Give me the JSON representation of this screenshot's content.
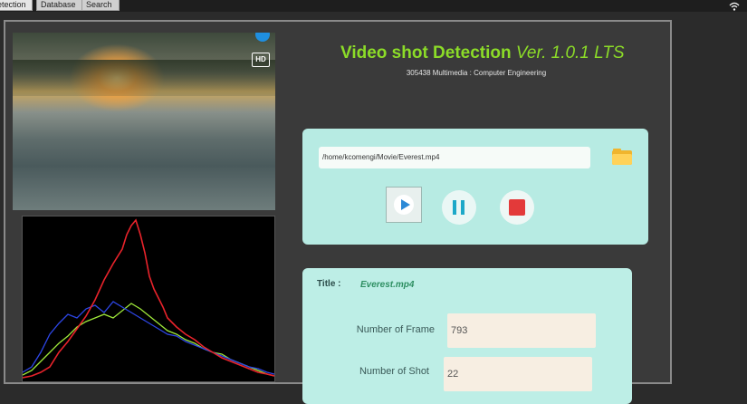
{
  "tabs": [
    "etection",
    "Database",
    "Search"
  ],
  "app": {
    "title_main": "Video shot Detection",
    "title_version": "Ver. 1.0.1 LTS",
    "subtitle": "305438 Multimedia : Computer Engineering"
  },
  "video": {
    "badge": "HD"
  },
  "file": {
    "path": "/home/kcomengi/Movie/Everest.mp4"
  },
  "info": {
    "title_label": "Title :",
    "title_value": "Everest.mp4",
    "frames_label": "Number of Frame",
    "frames_value": "793",
    "shots_label": "Number of Shot",
    "shots_value": "22"
  },
  "icons": {
    "folder": "folder-icon",
    "play": "play-icon",
    "pause": "pause-icon",
    "stop": "stop-icon",
    "wifi": "wifi-icon"
  },
  "colors": {
    "accent_green": "#8cdc28",
    "panel": "#b7ebe3",
    "hist_red": "#e8232b",
    "hist_green": "#9fe83a",
    "hist_blue": "#2d46e6"
  }
}
